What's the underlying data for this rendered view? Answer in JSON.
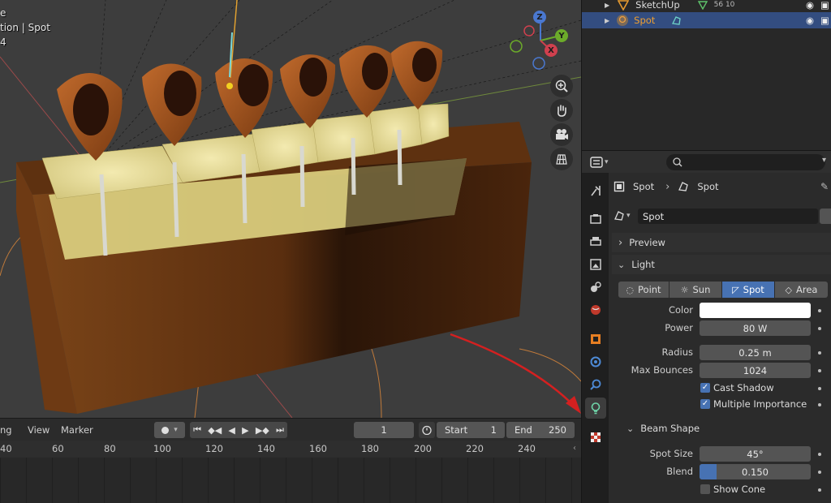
{
  "viewport": {
    "overlay_line1": "e",
    "overlay_line2": "tion | Spot",
    "overlay_line3": "4",
    "gizmo": {
      "z": "Z",
      "y": "Y",
      "x": "X"
    },
    "nav_icons": [
      "zoom-icon",
      "hand-icon",
      "camera-icon",
      "grid-icon"
    ]
  },
  "timeline": {
    "menu_playback": "ng",
    "menu_view": "View",
    "menu_marker": "Marker",
    "current_frame": "1",
    "start_label": "Start",
    "start_value": "1",
    "end_label": "End",
    "end_value": "250",
    "ruler": [
      "40",
      "60",
      "80",
      "100",
      "120",
      "140",
      "160",
      "180",
      "200",
      "220",
      "240"
    ]
  },
  "outliner": {
    "rows": [
      {
        "name": "SketchUp",
        "extra": "56  10",
        "selected": false
      },
      {
        "name": "Spot",
        "extra": "",
        "selected": true
      }
    ]
  },
  "properties": {
    "breadcrumb_object": "Spot",
    "breadcrumb_data": "Spot",
    "datablock_name": "Spot",
    "preview_label": "Preview",
    "light_label": "Light",
    "light_types": [
      "Point",
      "Sun",
      "Spot",
      "Area"
    ],
    "selected_light_type": "Spot",
    "color_label": "Color",
    "color_value": "#ffffff",
    "power_label": "Power",
    "power_value": "80 W",
    "radius_label": "Radius",
    "radius_value": "0.25 m",
    "max_bounces_label": "Max Bounces",
    "max_bounces_value": "1024",
    "cast_shadow_label": "Cast Shadow",
    "cast_shadow": true,
    "multiple_importance_label": "Multiple Importance",
    "multiple_importance": true,
    "beam_shape_label": "Beam Shape",
    "spot_size_label": "Spot Size",
    "spot_size_value": "45°",
    "blend_label": "Blend",
    "blend_value": "0.150",
    "blend_fraction": 0.15,
    "show_cone_label": "Show Cone",
    "show_cone": false
  },
  "colors": {
    "accent": "#4772b3",
    "selection": "#334d80",
    "wood": "#6b3a14",
    "foam": "#e8dc8a",
    "annotation_arrow": "#d42020"
  }
}
